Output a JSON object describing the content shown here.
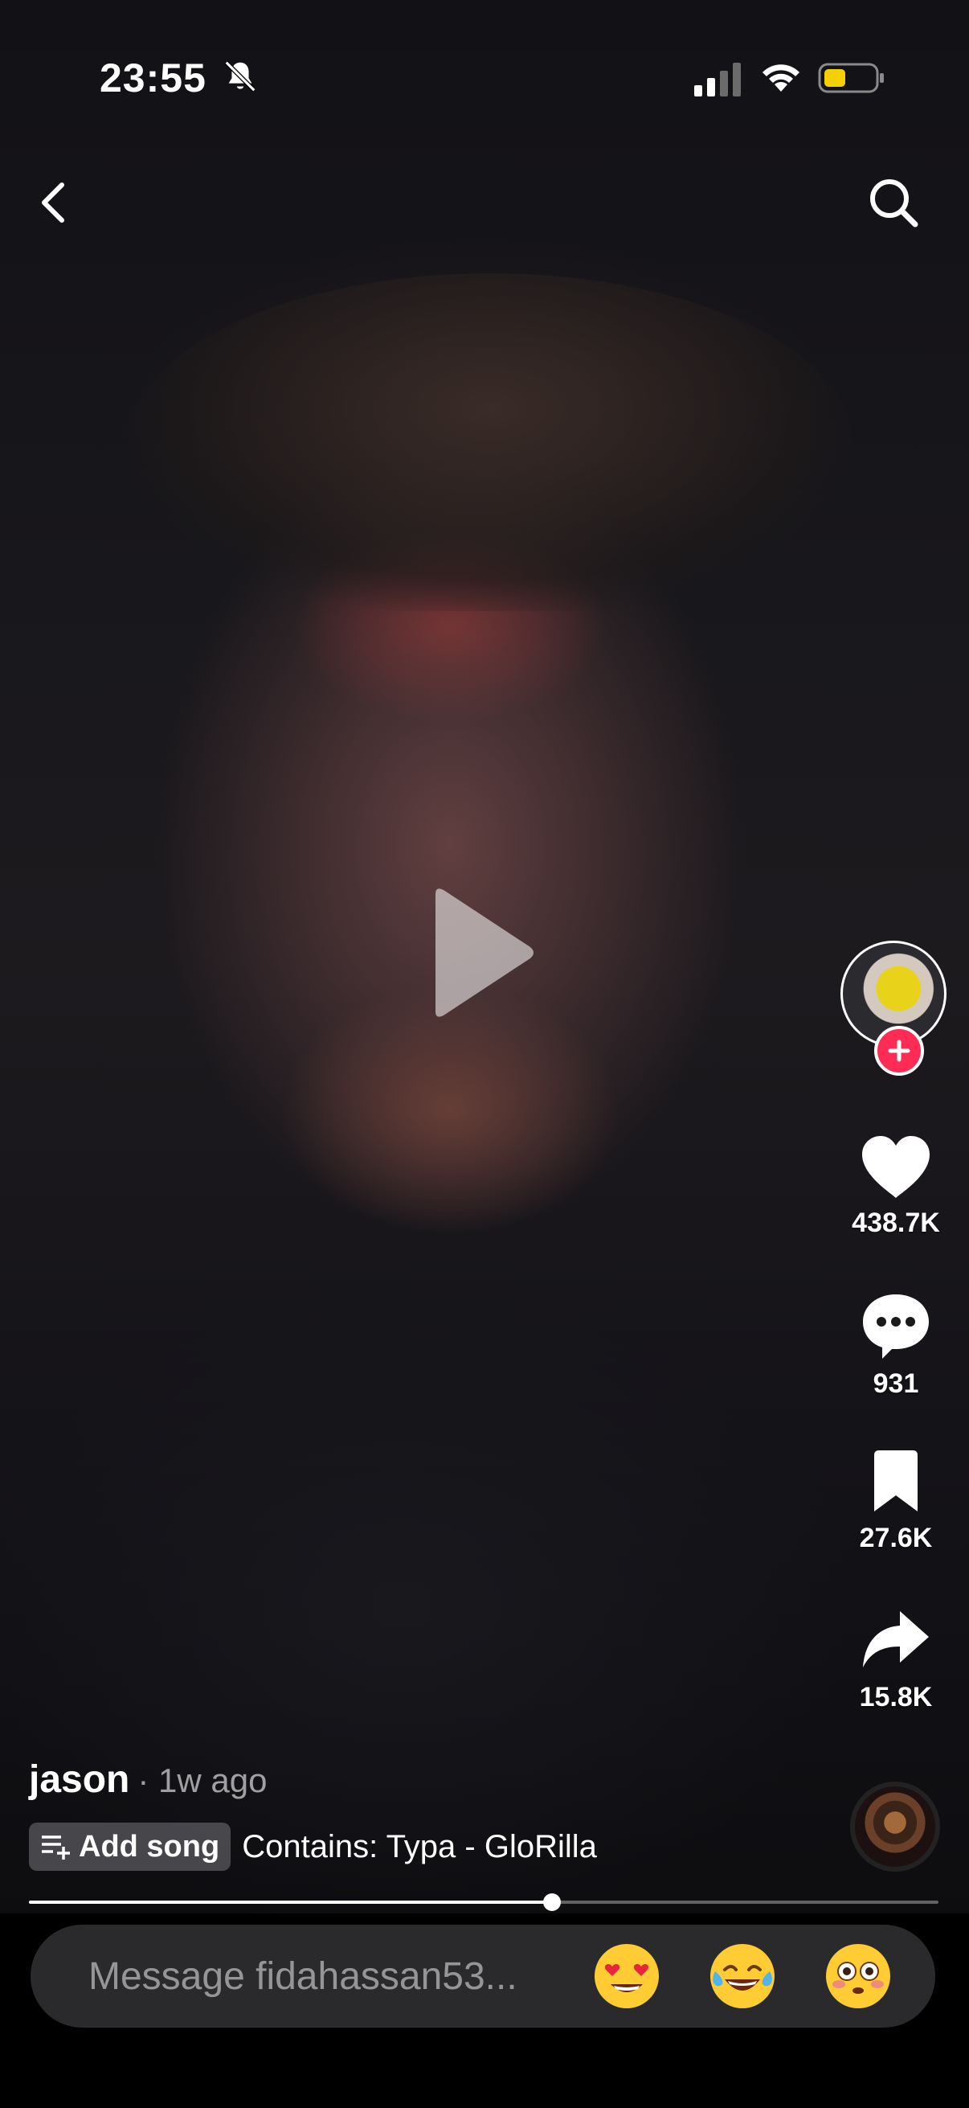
{
  "status_bar": {
    "time": "23:55",
    "silent_icon": "bell-slash-icon",
    "signal_icon": "cellular-signal-icon",
    "wifi_icon": "wifi-icon",
    "battery_icon": "battery-icon",
    "battery_color": "#f5d000"
  },
  "top_nav": {
    "back_icon": "chevron-left-icon",
    "search_icon": "search-icon"
  },
  "video": {
    "state_icon": "play-icon"
  },
  "creator": {
    "avatar_icon": "avatar",
    "follow_icon": "plus-icon",
    "follow_color": "#fe2c55"
  },
  "actions": {
    "like": {
      "icon": "heart-icon",
      "count": "438.7K"
    },
    "comment": {
      "icon": "comment-icon",
      "count": "931"
    },
    "bookmark": {
      "icon": "bookmark-icon",
      "count": "27.6K"
    },
    "share": {
      "icon": "share-icon",
      "count": "15.8K"
    }
  },
  "post": {
    "author": "jason",
    "posted": "· 1w ago",
    "add_song_label": "Add song",
    "contains": "Contains: Typa - GloRilla"
  },
  "progress": {
    "fraction": 0.575
  },
  "message_bar": {
    "placeholder": "Message fidahassan53...",
    "emojis": [
      "heart-eyes-emoji",
      "tears-of-joy-emoji",
      "flushed-emoji"
    ]
  }
}
